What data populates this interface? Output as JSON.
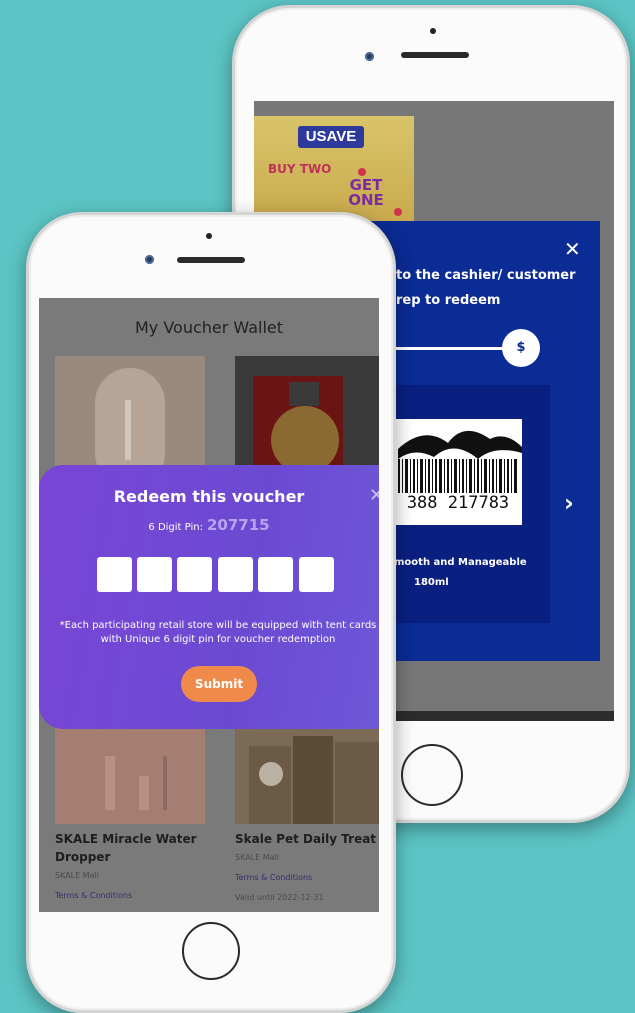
{
  "back_screen": {
    "promo": {
      "brand": "USAVE",
      "line1": "BUY TWO",
      "line2": "GET ONE"
    },
    "redeem_panel": {
      "instruction": "to the cashier/ customer rep to redeem",
      "slider_symbol": "$",
      "barcode_number": "388 217783",
      "product_line1": "mooth and Manageable",
      "product_line2": "180ml",
      "close_icon": "close-icon",
      "next_icon": "chevron-right-icon"
    }
  },
  "front_screen": {
    "title": "My Voucher Wallet",
    "vouchers": [
      {
        "name": "SKALE Miracle Water Dropper",
        "merchant": "SKALE Mall",
        "terms": "Terms & Conditions"
      },
      {
        "name": "Skale Pet Daily Treat",
        "merchant": "SKALE Mall",
        "terms": "Terms & Conditions",
        "valid": "Valid until 2022-12-31"
      }
    ],
    "modal": {
      "title": "Redeem this voucher",
      "pin_label": "6 Digit Pin:",
      "pin_value": "207715",
      "pin_boxes": [
        "",
        "",
        "",
        "",
        "",
        ""
      ],
      "note": "*Each participating retail store will be equipped with tent cards with Unique 6 digit pin for voucher redemption",
      "submit_label": "Submit",
      "close_icon": "close-icon"
    }
  },
  "colors": {
    "background": "#5cc4c4",
    "redeem_panel": "#0b2b95",
    "modal_purple": "#7a45d6",
    "submit_orange": "#f08a4b"
  }
}
